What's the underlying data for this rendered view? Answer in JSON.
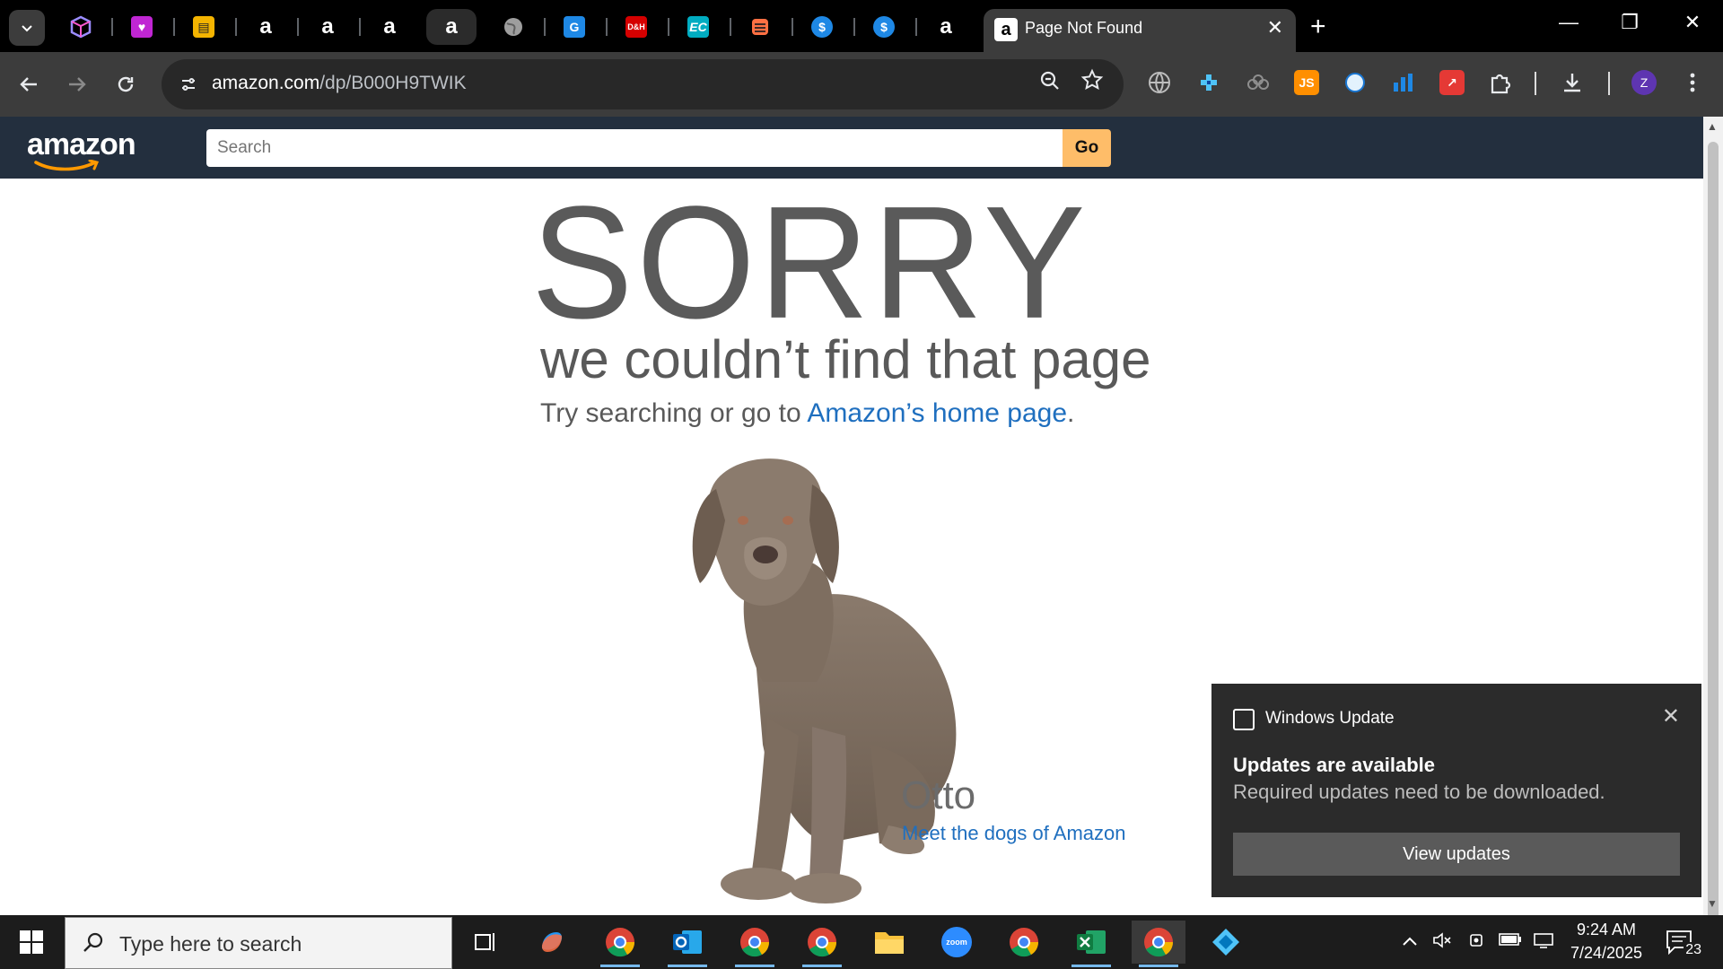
{
  "browser": {
    "pinned_tabs": [
      {
        "icon": "cube-icon",
        "color": "#7b61ff"
      },
      {
        "icon": "heart-app-icon",
        "color": "#c026d3"
      },
      {
        "icon": "book-icon",
        "color": "#f4b400"
      },
      {
        "icon": "amazon-icon",
        "color": "#ffffff"
      },
      {
        "icon": "amazon-icon",
        "color": "#ffffff"
      },
      {
        "icon": "amazon-icon",
        "color": "#ffffff"
      },
      {
        "icon": "amazon-icon",
        "color": "#ffffff"
      },
      {
        "icon": "globe-icon",
        "color": "#9e9e9e"
      },
      {
        "icon": "g-app-icon",
        "color": "#1e88e5"
      },
      {
        "icon": "dh-icon",
        "color": "#d50000"
      },
      {
        "icon": "ec-icon",
        "color": "#00bcd4"
      },
      {
        "icon": "stack-icon",
        "color": "#ff7043"
      },
      {
        "icon": "dollar-icon",
        "color": "#1e88e5"
      },
      {
        "icon": "dollar-icon",
        "color": "#1e88e5"
      },
      {
        "icon": "amazon-icon",
        "color": "#ffffff"
      }
    ],
    "active_tab": {
      "title": "Page Not Found",
      "close": "✕"
    },
    "new_tab": "+",
    "window_controls": {
      "minimize": "—",
      "restore": "❐",
      "close": "✕"
    },
    "address": {
      "host": "amazon.com",
      "path": "/dp/B000H9TWIK"
    },
    "profile_initial": "Z"
  },
  "amazon": {
    "logo": "amazon",
    "search_placeholder": "Search",
    "go_label": "Go",
    "sorry": "SORRY",
    "couldnt": "we couldn’t find that page",
    "try_prefix": "Try searching or go to ",
    "home_link": "Amazon’s home page",
    "try_suffix": ".",
    "dog_name": "Otto",
    "meet_link": "Meet the dogs of Amazon"
  },
  "toast": {
    "app": "Windows Update",
    "title": "Updates are available",
    "body": "Required updates need to be downloaded.",
    "button": "View updates"
  },
  "taskbar": {
    "search_placeholder": "Type here to search",
    "time": "9:24 AM",
    "date": "7/24/2025",
    "notification_count": "23"
  }
}
